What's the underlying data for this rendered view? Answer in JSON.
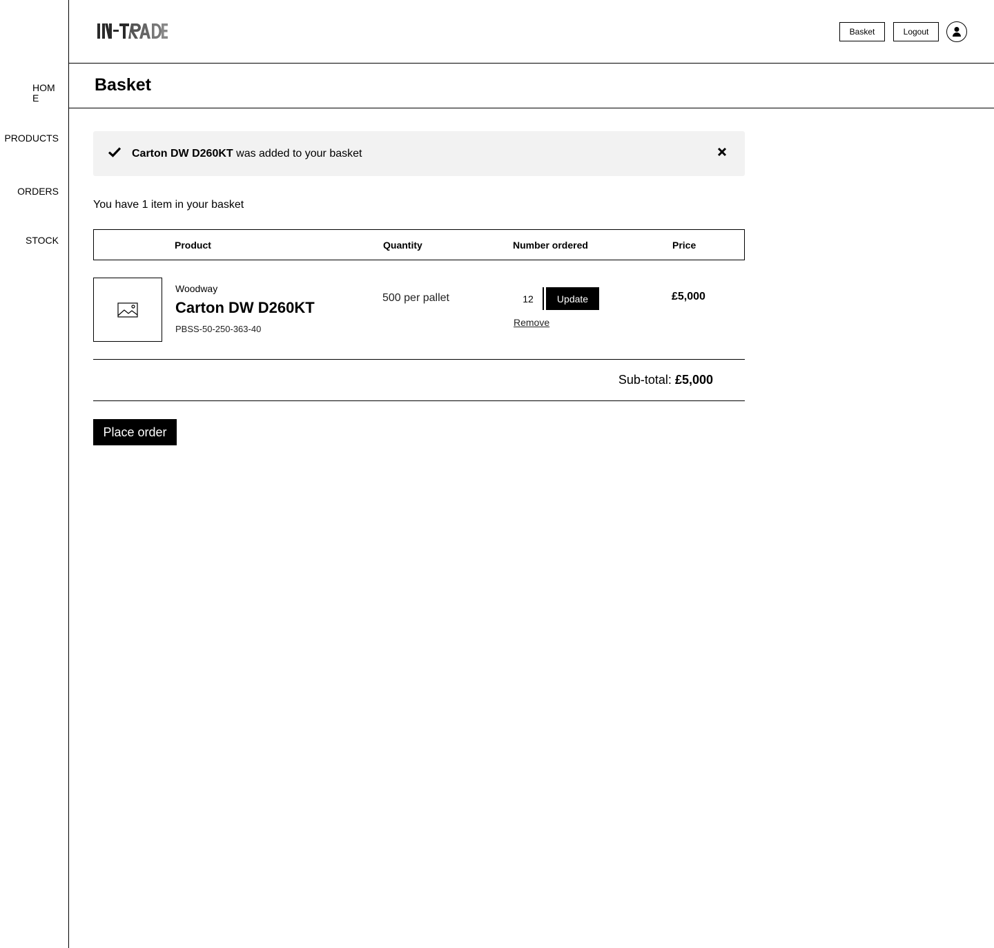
{
  "app": {
    "logo_text": "IN-TRADE"
  },
  "sidebar": {
    "items": [
      {
        "label": "HOME"
      },
      {
        "label": "PRODUCTS"
      },
      {
        "label": "ORDERS"
      },
      {
        "label": "STOCK"
      }
    ]
  },
  "header": {
    "basket_label": "Basket",
    "logout_label": "Logout",
    "avatar_icon": "user-icon"
  },
  "page": {
    "title": "Basket"
  },
  "notice": {
    "icon": "check-icon",
    "product": "Carton DW D260KT",
    "message": " was added to your basket",
    "close_icon": "close-icon"
  },
  "basket": {
    "count_text": "You have 1 item in your basket",
    "columns": [
      "Product",
      "Quantity",
      "Number ordered",
      "Price"
    ],
    "items": [
      {
        "thumbnail_icon": "image-placeholder-icon",
        "brand": "Woodway",
        "name": "Carton DW D260KT",
        "sku": "PBSS-50-250-363-40",
        "quantity": "500 per pallet",
        "number_ordered": "12",
        "update_label": "Update",
        "remove_label": "Remove",
        "price": "£5,000"
      }
    ],
    "subtotal_label": "Sub-total: ",
    "subtotal_value": "£5,000",
    "place_order_label": "Place order"
  }
}
